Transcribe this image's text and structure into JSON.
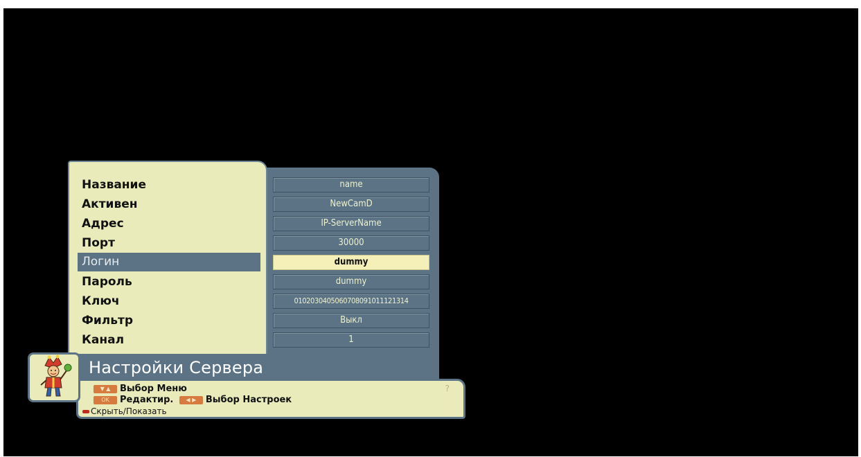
{
  "menu": {
    "items": [
      {
        "label": "Название",
        "value": "name",
        "selected": false
      },
      {
        "label": "Активен",
        "value": "NewCamD",
        "selected": false
      },
      {
        "label": "Адрес",
        "value": "IP-ServerName",
        "selected": false
      },
      {
        "label": "Порт",
        "value": "30000",
        "selected": false
      },
      {
        "label": "Логин",
        "value": "dummy",
        "selected": true
      },
      {
        "label": "Пароль",
        "value": "dummy",
        "selected": false
      },
      {
        "label": "Ключ",
        "value": "0102030405060708091011121314",
        "selected": false
      },
      {
        "label": "Фильтр",
        "value": "Выкл",
        "selected": false
      },
      {
        "label": "Канал",
        "value": "1",
        "selected": false
      }
    ]
  },
  "title": "Настройки Сервера",
  "help": {
    "line1": "Выбор Меню",
    "line2a": "Редактир.",
    "line2b": "Выбор Настроек",
    "line3": "Скрыть/Показать",
    "ok_key": "OK",
    "question": "?"
  },
  "colors": {
    "panel_cream": "#e9ecba",
    "panel_slate": "#5b7384",
    "selected_value": "#f4f0b8",
    "key_orange": "#d77a3f",
    "red_key": "#c22a1d"
  }
}
